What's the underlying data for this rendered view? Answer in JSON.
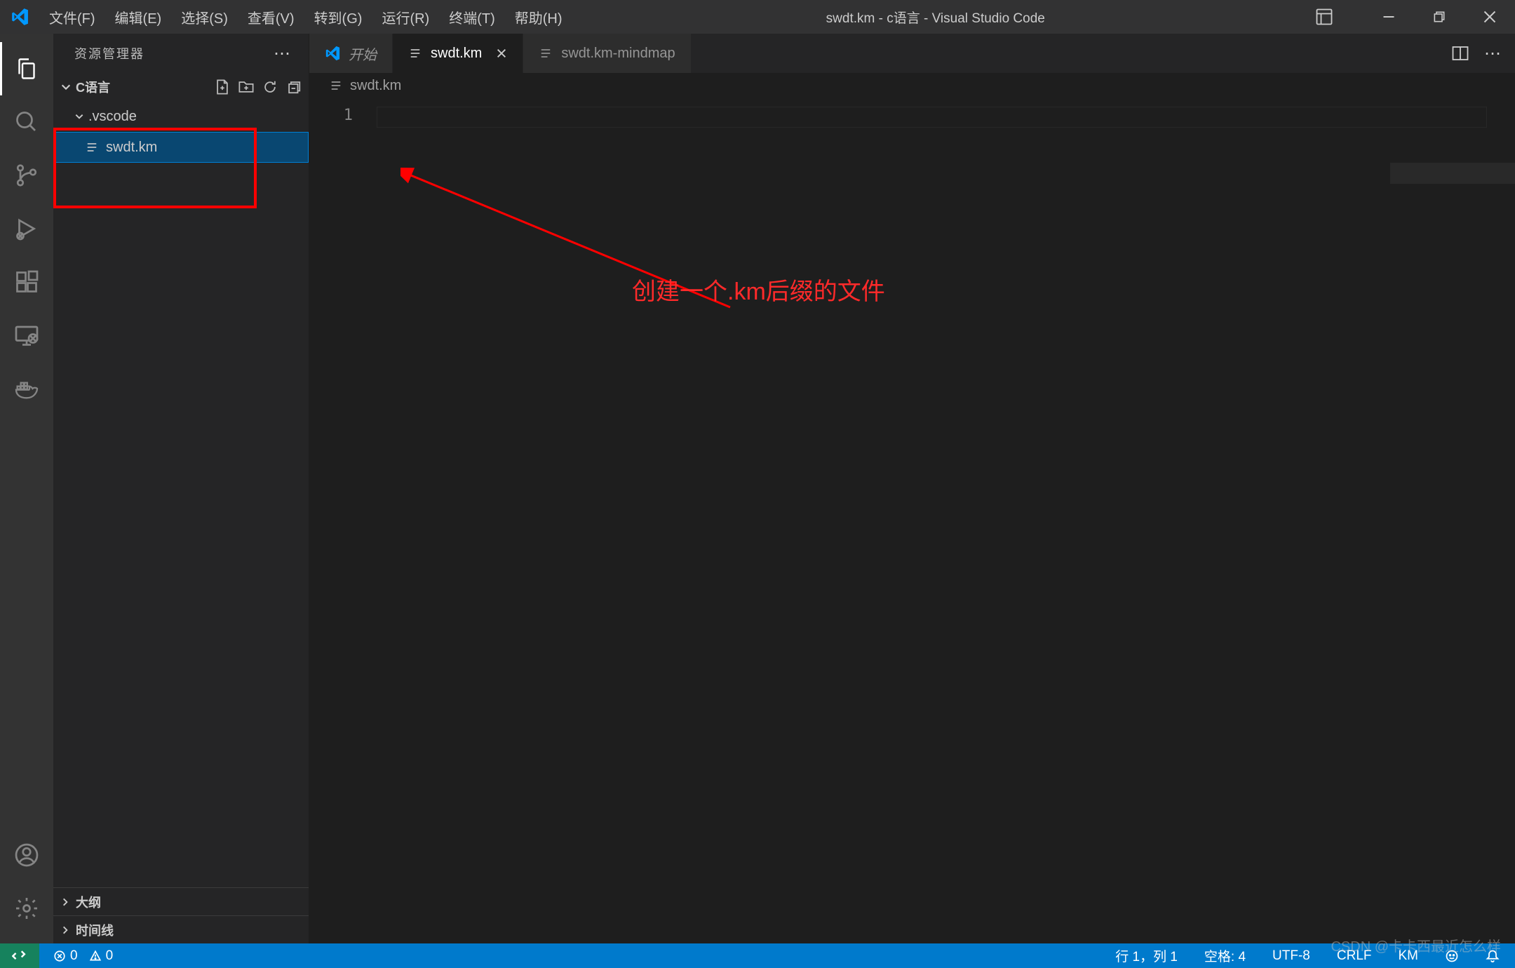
{
  "menu": {
    "file": "文件(F)",
    "edit": "编辑(E)",
    "select": "选择(S)",
    "view": "查看(V)",
    "go": "转到(G)",
    "run": "运行(R)",
    "terminal": "终端(T)",
    "help": "帮助(H)"
  },
  "window_title": "swdt.km - c语言 - Visual Studio Code",
  "sidebar": {
    "title": "资源管理器",
    "folder_name": "C语言",
    "items": {
      "vscode_folder": ".vscode",
      "swdt_file": "swdt.km"
    },
    "outline": "大纲",
    "timeline": "时间线"
  },
  "tabs": {
    "start": "开始",
    "swdt": "swdt.km",
    "mindmap": "swdt.km-mindmap"
  },
  "breadcrumb": {
    "file": "swdt.km"
  },
  "editor": {
    "line_number": "1"
  },
  "annotation": {
    "text": "创建一个.km后缀的文件"
  },
  "statusbar": {
    "errors": "0",
    "warnings": "0",
    "ln_col": "行 1，列 1",
    "spaces": "空格: 4",
    "encoding": "UTF-8",
    "eol": "CRLF",
    "lang": "KM"
  },
  "watermark": "CSDN @卡卡西最近怎么样"
}
